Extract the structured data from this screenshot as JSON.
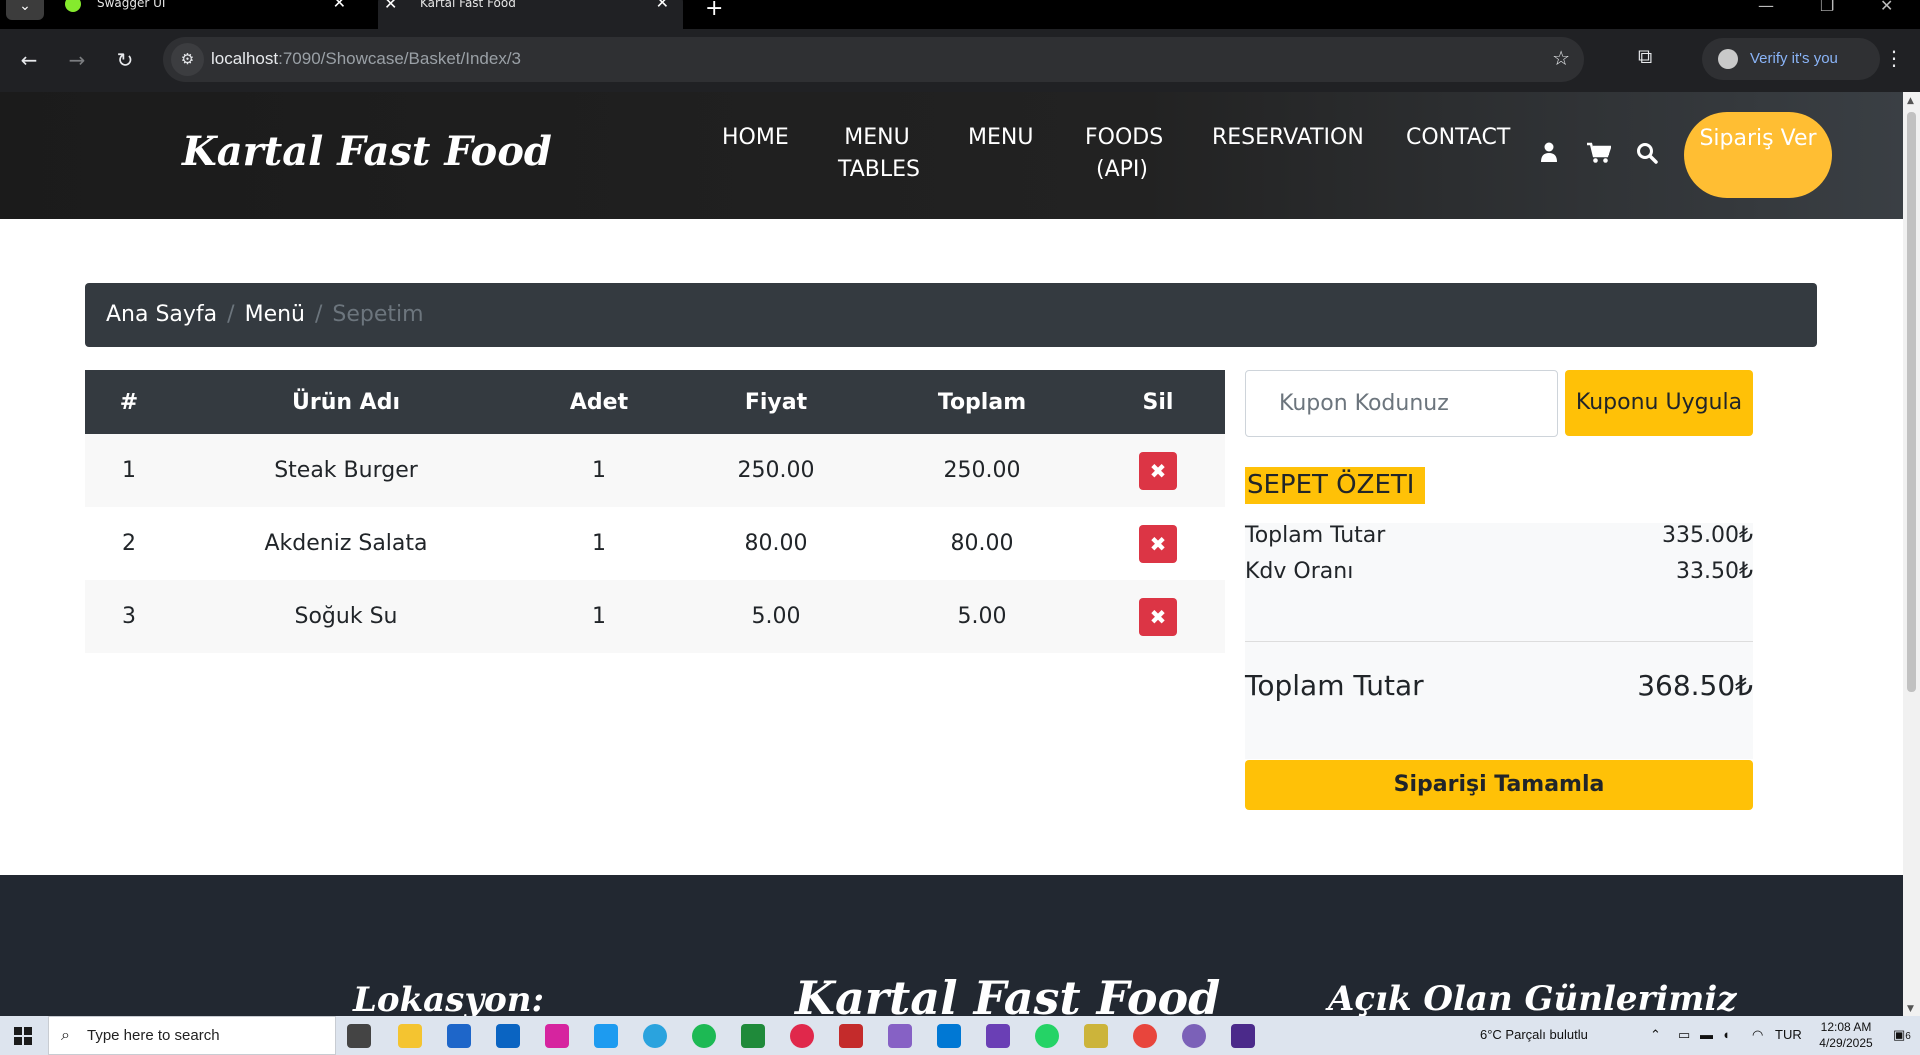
{
  "browser": {
    "tabs": [
      {
        "title": "Swagger UI"
      },
      {
        "title": "Kartal Fast Food"
      }
    ],
    "url_host": "localhost",
    "url_rest": ":7090/Showcase/Basket/Index/3",
    "profile_label": "Verify it's you"
  },
  "site": {
    "brand": "Kartal Fast Food",
    "nav": [
      {
        "label": "HOME"
      },
      {
        "label": "MENU TABLES"
      },
      {
        "label": "MENU"
      },
      {
        "label": "FOODS (API)"
      },
      {
        "label": "RESERVATION"
      },
      {
        "label": "CONTACT"
      }
    ],
    "order_button": "Sipariş Ver"
  },
  "breadcrumb": {
    "items": [
      "Ana Sayfa",
      "Menü"
    ],
    "active": "Sepetim"
  },
  "cart": {
    "headers": [
      "#",
      "Ürün Adı",
      "Adet",
      "Fiyat",
      "Toplam",
      "Sil"
    ],
    "rows": [
      {
        "no": "1",
        "name": "Steak Burger",
        "qty": "1",
        "price": "250.00",
        "total": "250.00"
      },
      {
        "no": "2",
        "name": "Akdeniz Salata",
        "qty": "1",
        "price": "80.00",
        "total": "80.00"
      },
      {
        "no": "3",
        "name": "Soğuk Su",
        "qty": "1",
        "price": "5.00",
        "total": "5.00"
      }
    ]
  },
  "coupon": {
    "placeholder": "Kupon Kodunuz",
    "button": "Kuponu Uygula"
  },
  "summary": {
    "title": "SEPET ÖZETI",
    "subtotal_label": "Toplam Tutar",
    "subtotal_value": "335.00₺",
    "tax_label": "Kdv Oranı",
    "tax_value": "33.50₺",
    "grand_label": "Toplam Tutar",
    "grand_value": "368.50₺",
    "complete_button": "Siparişi Tamamla"
  },
  "footer": {
    "headings": [
      "Lokasyon:",
      "Kartal Fast Food",
      "Açık Olan Günlerimiz"
    ]
  },
  "taskbar": {
    "search_placeholder": "Type here to search",
    "weather": "6°C  Parçalı bulutlu",
    "language": "TUR",
    "time": "12:08 AM",
    "date": "4/29/2025",
    "notification_count": "6"
  },
  "colors": {
    "accent": "#ffbe33",
    "warning": "#ffc107",
    "danger": "#dc3545",
    "dark": "#343a40"
  }
}
